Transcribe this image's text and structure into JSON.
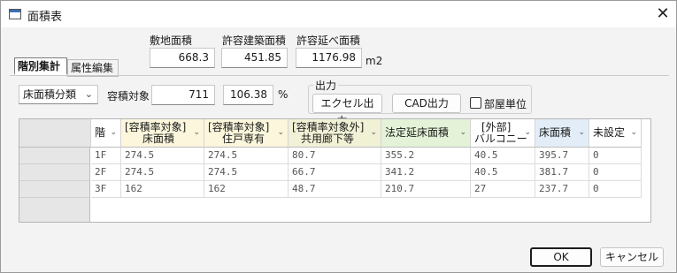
{
  "window": {
    "title": "面積表",
    "close_glyph": "✕"
  },
  "summary": {
    "site_area_label": "敷地面積",
    "site_area_value": "668.3",
    "allowed_building_label": "許容建築面積",
    "allowed_building_value": "451.85",
    "allowed_floor_label": "許容延べ面積",
    "allowed_floor_value": "1176.98",
    "unit": "m2"
  },
  "tabs": [
    {
      "label": "階別集計",
      "active": true
    },
    {
      "label": "属性編集",
      "active": false
    }
  ],
  "filter": {
    "category_select": "床面積分類",
    "target_label": "容積対象",
    "target_value": "711",
    "percent_value": "106.38",
    "percent_unit": "%"
  },
  "output": {
    "group_label": "出力",
    "excel_button": "エクセル出力...",
    "cad_button": "CAD出力",
    "room_unit_label": "部屋単位",
    "room_unit_checked": false
  },
  "table": {
    "columns": [
      {
        "line1": "階",
        "line2": "",
        "bg": "#ffffff"
      },
      {
        "line1": "[容積率対象]",
        "line2": "床面積",
        "bg": "#fbf6dc"
      },
      {
        "line1": "[容積率対象]",
        "line2": "住戸専有",
        "bg": "#fbf6dc"
      },
      {
        "line1": "[容積率対象外]",
        "line2": "共用廊下等",
        "bg": "#f1f1d6"
      },
      {
        "line1": "法定延床面積",
        "line2": "",
        "bg": "#e4f3d8"
      },
      {
        "line1": "[外部]",
        "line2": "バルコニー",
        "bg": "#ffffff"
      },
      {
        "line1": "床面積",
        "line2": "",
        "bg": "#e2edf8"
      },
      {
        "line1": "未設定",
        "line2": "",
        "bg": "#ffffff"
      }
    ],
    "rows": [
      [
        "1F",
        "274.5",
        "274.5",
        "80.7",
        "355.2",
        "40.5",
        "395.7",
        "0"
      ],
      [
        "2F",
        "274.5",
        "274.5",
        "66.7",
        "341.2",
        "40.5",
        "381.7",
        "0"
      ],
      [
        "3F",
        "162",
        "162",
        "48.7",
        "210.7",
        "27",
        "237.7",
        "0"
      ]
    ]
  },
  "footer": {
    "ok_button": "OK",
    "cancel_button": "キャンセル"
  },
  "icons": {
    "sort_arrow": "⌄",
    "dropdown": "⌄"
  }
}
